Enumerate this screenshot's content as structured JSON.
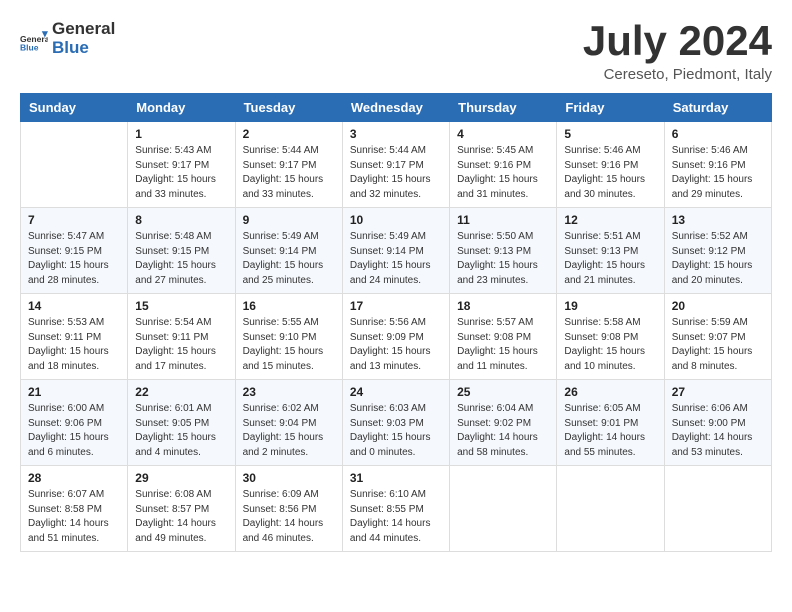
{
  "header": {
    "logo_general": "General",
    "logo_blue": "Blue",
    "month_title": "July 2024",
    "location": "Cereseto, Piedmont, Italy"
  },
  "columns": [
    "Sunday",
    "Monday",
    "Tuesday",
    "Wednesday",
    "Thursday",
    "Friday",
    "Saturday"
  ],
  "weeks": [
    [
      {
        "day": "",
        "info": ""
      },
      {
        "day": "1",
        "info": "Sunrise: 5:43 AM\nSunset: 9:17 PM\nDaylight: 15 hours\nand 33 minutes."
      },
      {
        "day": "2",
        "info": "Sunrise: 5:44 AM\nSunset: 9:17 PM\nDaylight: 15 hours\nand 33 minutes."
      },
      {
        "day": "3",
        "info": "Sunrise: 5:44 AM\nSunset: 9:17 PM\nDaylight: 15 hours\nand 32 minutes."
      },
      {
        "day": "4",
        "info": "Sunrise: 5:45 AM\nSunset: 9:16 PM\nDaylight: 15 hours\nand 31 minutes."
      },
      {
        "day": "5",
        "info": "Sunrise: 5:46 AM\nSunset: 9:16 PM\nDaylight: 15 hours\nand 30 minutes."
      },
      {
        "day": "6",
        "info": "Sunrise: 5:46 AM\nSunset: 9:16 PM\nDaylight: 15 hours\nand 29 minutes."
      }
    ],
    [
      {
        "day": "7",
        "info": "Sunrise: 5:47 AM\nSunset: 9:15 PM\nDaylight: 15 hours\nand 28 minutes."
      },
      {
        "day": "8",
        "info": "Sunrise: 5:48 AM\nSunset: 9:15 PM\nDaylight: 15 hours\nand 27 minutes."
      },
      {
        "day": "9",
        "info": "Sunrise: 5:49 AM\nSunset: 9:14 PM\nDaylight: 15 hours\nand 25 minutes."
      },
      {
        "day": "10",
        "info": "Sunrise: 5:49 AM\nSunset: 9:14 PM\nDaylight: 15 hours\nand 24 minutes."
      },
      {
        "day": "11",
        "info": "Sunrise: 5:50 AM\nSunset: 9:13 PM\nDaylight: 15 hours\nand 23 minutes."
      },
      {
        "day": "12",
        "info": "Sunrise: 5:51 AM\nSunset: 9:13 PM\nDaylight: 15 hours\nand 21 minutes."
      },
      {
        "day": "13",
        "info": "Sunrise: 5:52 AM\nSunset: 9:12 PM\nDaylight: 15 hours\nand 20 minutes."
      }
    ],
    [
      {
        "day": "14",
        "info": "Sunrise: 5:53 AM\nSunset: 9:11 PM\nDaylight: 15 hours\nand 18 minutes."
      },
      {
        "day": "15",
        "info": "Sunrise: 5:54 AM\nSunset: 9:11 PM\nDaylight: 15 hours\nand 17 minutes."
      },
      {
        "day": "16",
        "info": "Sunrise: 5:55 AM\nSunset: 9:10 PM\nDaylight: 15 hours\nand 15 minutes."
      },
      {
        "day": "17",
        "info": "Sunrise: 5:56 AM\nSunset: 9:09 PM\nDaylight: 15 hours\nand 13 minutes."
      },
      {
        "day": "18",
        "info": "Sunrise: 5:57 AM\nSunset: 9:08 PM\nDaylight: 15 hours\nand 11 minutes."
      },
      {
        "day": "19",
        "info": "Sunrise: 5:58 AM\nSunset: 9:08 PM\nDaylight: 15 hours\nand 10 minutes."
      },
      {
        "day": "20",
        "info": "Sunrise: 5:59 AM\nSunset: 9:07 PM\nDaylight: 15 hours\nand 8 minutes."
      }
    ],
    [
      {
        "day": "21",
        "info": "Sunrise: 6:00 AM\nSunset: 9:06 PM\nDaylight: 15 hours\nand 6 minutes."
      },
      {
        "day": "22",
        "info": "Sunrise: 6:01 AM\nSunset: 9:05 PM\nDaylight: 15 hours\nand 4 minutes."
      },
      {
        "day": "23",
        "info": "Sunrise: 6:02 AM\nSunset: 9:04 PM\nDaylight: 15 hours\nand 2 minutes."
      },
      {
        "day": "24",
        "info": "Sunrise: 6:03 AM\nSunset: 9:03 PM\nDaylight: 15 hours\nand 0 minutes."
      },
      {
        "day": "25",
        "info": "Sunrise: 6:04 AM\nSunset: 9:02 PM\nDaylight: 14 hours\nand 58 minutes."
      },
      {
        "day": "26",
        "info": "Sunrise: 6:05 AM\nSunset: 9:01 PM\nDaylight: 14 hours\nand 55 minutes."
      },
      {
        "day": "27",
        "info": "Sunrise: 6:06 AM\nSunset: 9:00 PM\nDaylight: 14 hours\nand 53 minutes."
      }
    ],
    [
      {
        "day": "28",
        "info": "Sunrise: 6:07 AM\nSunset: 8:58 PM\nDaylight: 14 hours\nand 51 minutes."
      },
      {
        "day": "29",
        "info": "Sunrise: 6:08 AM\nSunset: 8:57 PM\nDaylight: 14 hours\nand 49 minutes."
      },
      {
        "day": "30",
        "info": "Sunrise: 6:09 AM\nSunset: 8:56 PM\nDaylight: 14 hours\nand 46 minutes."
      },
      {
        "day": "31",
        "info": "Sunrise: 6:10 AM\nSunset: 8:55 PM\nDaylight: 14 hours\nand 44 minutes."
      },
      {
        "day": "",
        "info": ""
      },
      {
        "day": "",
        "info": ""
      },
      {
        "day": "",
        "info": ""
      }
    ]
  ]
}
